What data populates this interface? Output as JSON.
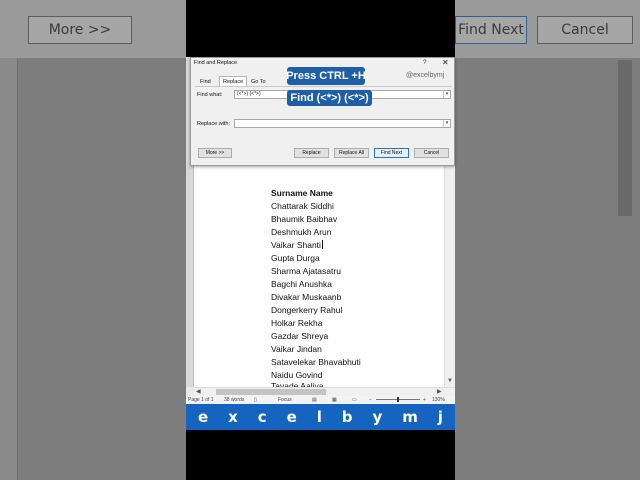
{
  "background": {
    "left_button": "More >>",
    "right_buttons": [
      "Find Next",
      "Cancel"
    ]
  },
  "dialog": {
    "title": "Find and Replace",
    "help": "?",
    "close": "✕",
    "tabs": [
      "Find",
      "Replace",
      "Go To"
    ],
    "active_tab": "Replace",
    "find_label": "Find what:",
    "find_value": "(<*>) (<*>)",
    "replace_label": "Replace with:",
    "replace_value": "",
    "buttons": {
      "more": "More >>",
      "replace": "Replace",
      "replace_all": "Replace All",
      "find_next": "Find Next",
      "cancel": "Cancel"
    }
  },
  "overlay": {
    "shortcut": "Press CTRL +H",
    "find_hint": "Find (<*>) (<*>)",
    "handle": "@excelbymj"
  },
  "document": {
    "heading": "Surname Name",
    "names": [
      "Chattarak Siddhi",
      "Bhaumik Baibhav",
      "Deshmukh Arun",
      "Vaikar Shanti",
      "Gupta Durga",
      "Sharma Ajatasatru",
      "Bagchi Anushka",
      "Divakar Muskaanb",
      "Dongerkerry Rahul",
      "Holkar Rekha",
      "Gazdar Shreya",
      "Vaikar Jindan",
      "Satavelekar Bhavabhuti",
      "Naidu Govind",
      "Tavade Aaliya"
    ]
  },
  "statusbar": {
    "page": "Page 1 of 1",
    "words": "38 words",
    "focus": "Focus",
    "zoom": "130%"
  },
  "letters": [
    "e",
    "x",
    "c",
    "e",
    "l",
    "b",
    "y",
    "m",
    "j"
  ],
  "colors": {
    "accent_blue": "#1f5fa8",
    "letter_bar": "#1565c0",
    "dialog_bg": "#f0f0f0"
  }
}
